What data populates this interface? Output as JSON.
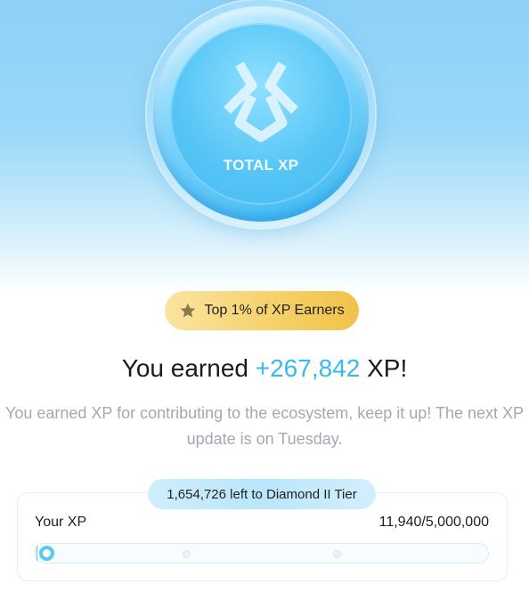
{
  "hero": {
    "coin_label": "TOTAL XP",
    "colors": {
      "sky": "#8dd2f7",
      "coin": "#43b9f1"
    }
  },
  "badge": {
    "icon": "star-icon",
    "label": "Top 1% of XP Earners",
    "color": "#f6d26b"
  },
  "headline": {
    "prefix": "You earned ",
    "value": "+267,842",
    "suffix": " XP!",
    "accent": "#37b9ee"
  },
  "subtext": "You earned XP for contributing to the ecosystem, keep it up! The next XP update is on Tuesday.",
  "progress_card": {
    "tier_pill": "1,654,726 left to Diamond II Tier",
    "label": "Your XP",
    "count": "11,940/5,000,000",
    "progress_fraction": 0.0024,
    "milestones": 2
  }
}
